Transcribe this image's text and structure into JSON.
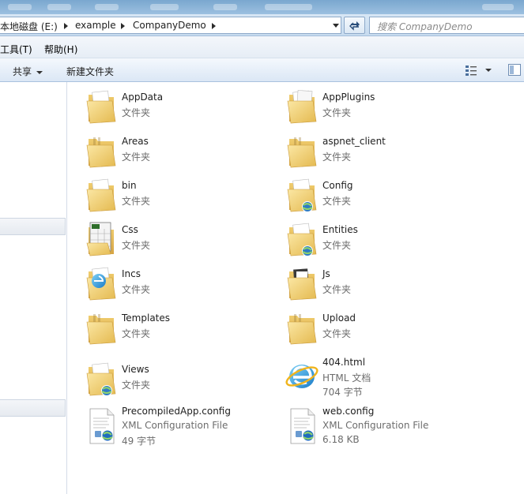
{
  "address": {
    "crumbs": [
      "本地磁盘 (E:)",
      "example",
      "CompanyDemo"
    ],
    "search_placeholder": "搜索 CompanyDemo"
  },
  "menu": {
    "tools": "工具(T)",
    "help": "帮助(H)"
  },
  "commands": {
    "share": "共享",
    "new_folder": "新建文件夹"
  },
  "items": [
    {
      "name": "AppData",
      "type": "文件夹",
      "icon": "folder-doc-icon"
    },
    {
      "name": "AppPlugins",
      "type": "文件夹",
      "icon": "folder-pages-icon"
    },
    {
      "name": "Areas",
      "type": "文件夹",
      "icon": "folder-icon"
    },
    {
      "name": "aspnet_client",
      "type": "文件夹",
      "icon": "folder-icon"
    },
    {
      "name": "bin",
      "type": "文件夹",
      "icon": "folder-doc-icon"
    },
    {
      "name": "Config",
      "type": "文件夹",
      "icon": "folder-globe-icon"
    },
    {
      "name": "Css",
      "type": "文件夹",
      "icon": "folder-css-icon"
    },
    {
      "name": "Entities",
      "type": "文件夹",
      "icon": "folder-globe-icon"
    },
    {
      "name": "Incs",
      "type": "文件夹",
      "icon": "folder-ie-icon"
    },
    {
      "name": "Js",
      "type": "文件夹",
      "icon": "folder-dark-doc-icon"
    },
    {
      "name": "Templates",
      "type": "文件夹",
      "icon": "folder-icon"
    },
    {
      "name": "Upload",
      "type": "文件夹",
      "icon": "folder-icon"
    },
    {
      "name": "Views",
      "type": "文件夹",
      "icon": "folder-globe-icon"
    },
    {
      "name": "404.html",
      "type": "HTML 文档",
      "size": "704 字节",
      "icon": "ie-html-icon"
    },
    {
      "name": "PrecompiledApp.config",
      "type": "XML Configuration File",
      "size": "49 字节",
      "icon": "config-file-icon"
    },
    {
      "name": "web.config",
      "type": "XML Configuration File",
      "size": "6.18 KB",
      "icon": "config-file-icon"
    }
  ]
}
